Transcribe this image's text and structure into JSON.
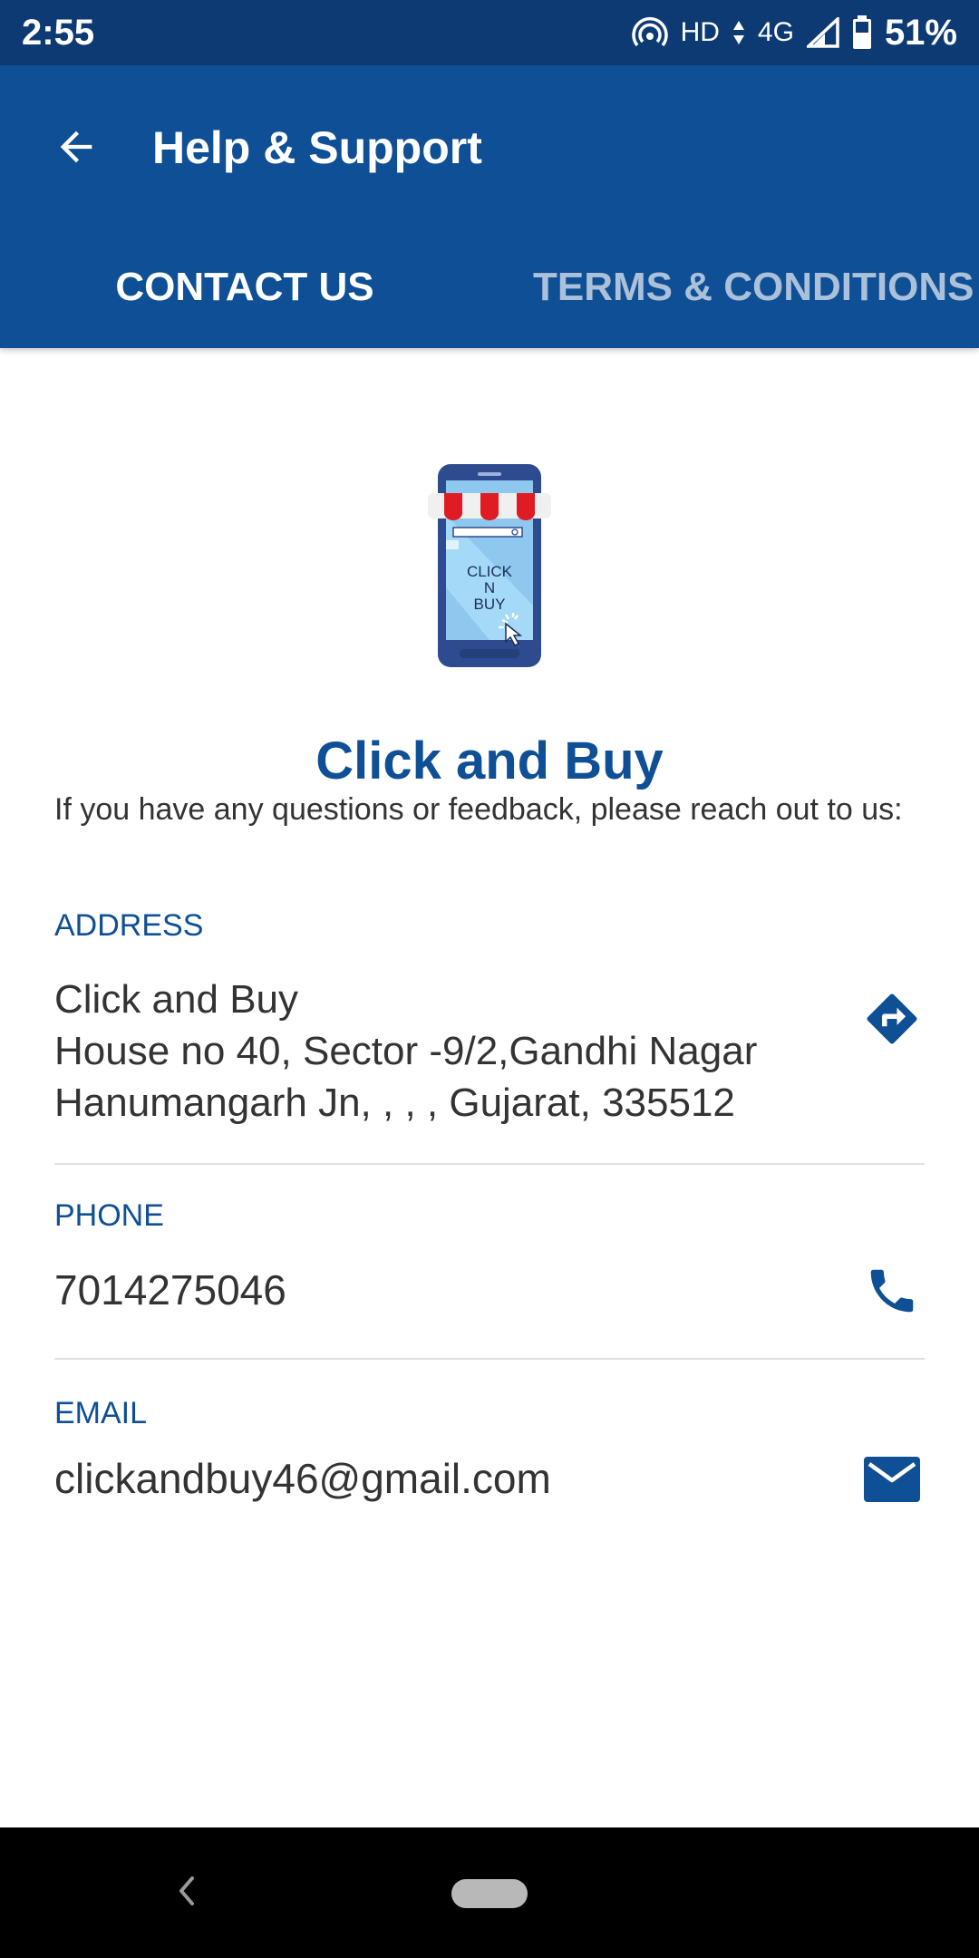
{
  "status_bar": {
    "time": "2:55",
    "hd": "HD",
    "network": "4G",
    "battery": "51%"
  },
  "app_bar": {
    "title": "Help & Support",
    "tabs": [
      {
        "label": "CONTACT US",
        "selected": true
      },
      {
        "label": "TERMS & CONDITIONS",
        "selected": false
      }
    ]
  },
  "logo": {
    "line1": "CLICK",
    "line2": "N",
    "line3": "BUY"
  },
  "company_name": "Click and Buy",
  "intro": "If you have any questions or feedback, please reach out to us:",
  "address": {
    "label": "ADDRESS",
    "line1": "Click and Buy",
    "line2": "House no 40, Sector -9/2,Gandhi Nagar",
    "line3": "Hanumangarh Jn, , , , Gujarat, 335512",
    "icon": "directions-icon"
  },
  "phone": {
    "label": "PHONE",
    "value": "7014275046",
    "icon": "phone-icon"
  },
  "email": {
    "label": "EMAIL",
    "value": "clickandbuy46@gmail.com",
    "icon": "mail-icon"
  },
  "colors": {
    "primary": "#0f4f95",
    "status_bar": "#0e3a73",
    "text": "#333333"
  }
}
